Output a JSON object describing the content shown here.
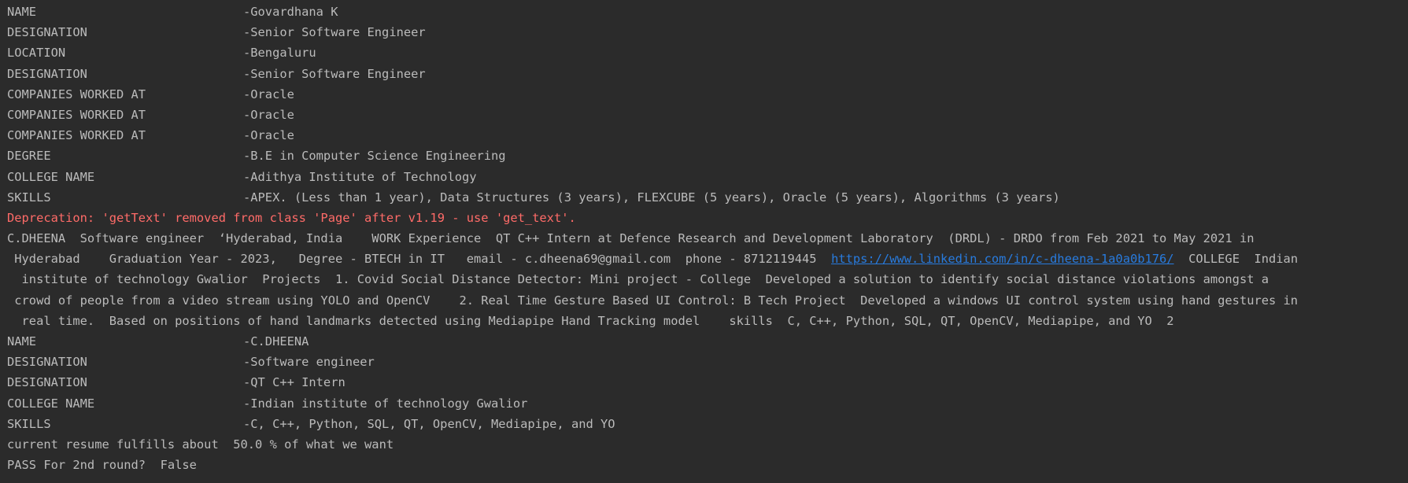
{
  "colors": {
    "background": "#2b2b2b",
    "text": "#bbbbbb",
    "error": "#ff6b68",
    "link": "#287bde"
  },
  "block1": [
    {
      "key": "NAME",
      "value": "-Govardhana K"
    },
    {
      "key": "DESIGNATION",
      "value": "-Senior Software Engineer"
    },
    {
      "key": "LOCATION",
      "value": "-Bengaluru"
    },
    {
      "key": "DESIGNATION",
      "value": "-Senior Software Engineer"
    },
    {
      "key": "COMPANIES WORKED AT",
      "value": "-Oracle"
    },
    {
      "key": "COMPANIES WORKED AT",
      "value": "-Oracle"
    },
    {
      "key": "COMPANIES WORKED AT",
      "value": "-Oracle"
    },
    {
      "key": "DEGREE",
      "value": "-B.E in Computer Science Engineering"
    },
    {
      "key": "COLLEGE NAME",
      "value": "-Adithya Institute of Technology"
    },
    {
      "key": "SKILLS",
      "value": "-APEX. (Less than 1 year), Data Structures (3 years), FLEXCUBE (5 years), Oracle (5 years), Algorithms (3 years)"
    }
  ],
  "warning": "Deprecation: 'getText' removed from class 'Page' after v1.19 - use 'get_text'.",
  "resume_text": {
    "line1": "C.DHEENA  Software engineer  ‘Hyderabad, India    WORK Experience  QT C++ Intern at Defence Research and Development Laboratory  (DRDL) - DRDO from Feb 2021 to May 2021 in",
    "line2_before": " Hyderabad    Graduation Year - 2023,   Degree - BTECH in IT   email - c.dheena69@gmail.com  phone - 8712119445  ",
    "line2_link": "https://www.linkedin.com/in/c-dheena-1a0a0b176/",
    "line2_after": "  COLLEGE  Indian",
    "line3": "  institute of technology Gwalior  Projects  1. Covid Social Distance Detector: Mini project - College  Developed a solution to identify social distance violations amongst a",
    "line4": " crowd of people from a video stream using YOLO and OpenCV    2. Real Time Gesture Based UI Control: B Tech Project  Developed a windows UI control system using hand gestures in",
    "line5": "  real time.  Based on positions of hand landmarks detected using Mediapipe Hand Tracking model    skills  C, C++, Python, SQL, QT, OpenCV, Mediapipe, and YO  2"
  },
  "block2": [
    {
      "key": "NAME",
      "value": "-C.DHEENA"
    },
    {
      "key": "DESIGNATION",
      "value": "-Software engineer"
    },
    {
      "key": "DESIGNATION",
      "value": "-QT C++ Intern"
    },
    {
      "key": "COLLEGE NAME",
      "value": "-Indian institute of technology Gwalior"
    },
    {
      "key": "SKILLS",
      "value": "-C, C++, Python, SQL, QT, OpenCV, Mediapipe, and YO"
    }
  ],
  "summary": {
    "fulfills": "current resume fulfills about  50.0 % of what we want",
    "pass": "PASS For 2nd round?  False"
  }
}
